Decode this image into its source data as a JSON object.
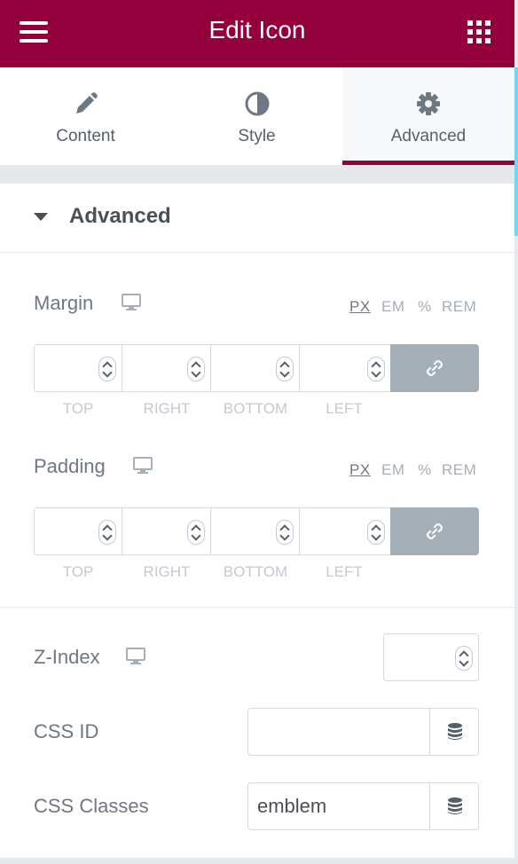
{
  "header": {
    "title": "Edit Icon",
    "menu_icon": "hamburger-menu-icon",
    "apps_icon": "grid-icon"
  },
  "tabs": [
    {
      "label": "Content",
      "icon": "pencil-icon"
    },
    {
      "label": "Style",
      "icon": "half-circle-icon"
    },
    {
      "label": "Advanced",
      "icon": "gear-icon",
      "active": true
    }
  ],
  "section": {
    "title": "Advanced"
  },
  "margin": {
    "label": "Margin",
    "units": [
      "PX",
      "EM",
      "%",
      "REM"
    ],
    "selected_unit": "PX",
    "fields": [
      "TOP",
      "RIGHT",
      "BOTTOM",
      "LEFT"
    ],
    "values": [
      "",
      "",
      "",
      ""
    ]
  },
  "padding": {
    "label": "Padding",
    "units": [
      "PX",
      "EM",
      "%",
      "REM"
    ],
    "selected_unit": "PX",
    "fields": [
      "TOP",
      "RIGHT",
      "BOTTOM",
      "LEFT"
    ],
    "values": [
      "",
      "",
      "",
      ""
    ]
  },
  "z_index": {
    "label": "Z-Index",
    "value": ""
  },
  "css_id": {
    "label": "CSS ID",
    "value": ""
  },
  "css_classes": {
    "label": "CSS Classes",
    "value": "emblem"
  },
  "colors": {
    "brand": "#93003c",
    "link_button": "#a4afb7",
    "scroll_indicator": "#71d7f7"
  }
}
